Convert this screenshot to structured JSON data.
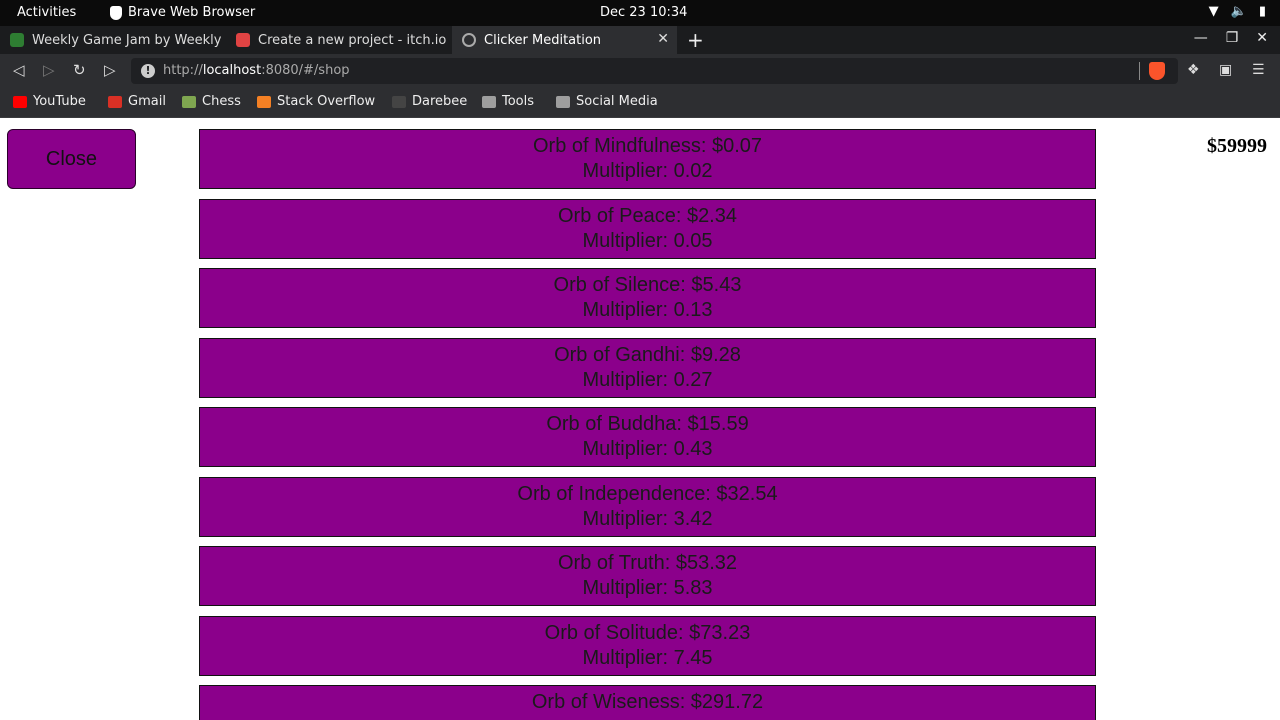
{
  "system": {
    "activities": "Activities",
    "app_name": "Brave Web Browser",
    "clock": "Dec 23  10:34"
  },
  "tabs": [
    {
      "title": "Weekly Game Jam by Weekly",
      "fav_color": "#2e7d32"
    },
    {
      "title": "Create a new project - itch.io",
      "fav_color": "#e04343"
    },
    {
      "title": "Clicker Meditation",
      "fav_color": "#666666"
    }
  ],
  "url": {
    "scheme": "http://",
    "host": "localhost",
    "rest": ":8080/#/shop"
  },
  "bookmarks": [
    {
      "label": "YouTube",
      "color": "#ff0000"
    },
    {
      "label": "Gmail",
      "color": "#d93025"
    },
    {
      "label": "Chess",
      "color": "#7fa650"
    },
    {
      "label": "Stack Overflow",
      "color": "#f48024"
    },
    {
      "label": "Darebee",
      "color": "#444444"
    },
    {
      "label": "Tools",
      "color": "#9e9e9e"
    },
    {
      "label": "Social Media",
      "color": "#9e9e9e"
    }
  ],
  "page": {
    "close_label": "Close",
    "balance": "$59999",
    "items": [
      {
        "name": "Orb of Mindfulness: $0.07",
        "multiplier": "Multiplier: 0.02"
      },
      {
        "name": "Orb of Peace: $2.34",
        "multiplier": "Multiplier: 0.05"
      },
      {
        "name": "Orb of Silence: $5.43",
        "multiplier": "Multiplier: 0.13"
      },
      {
        "name": "Orb of Gandhi: $9.28",
        "multiplier": "Multiplier: 0.27"
      },
      {
        "name": "Orb of Buddha: $15.59",
        "multiplier": "Multiplier: 0.43"
      },
      {
        "name": "Orb of Independence: $32.54",
        "multiplier": "Multiplier: 3.42"
      },
      {
        "name": "Orb of Truth: $53.32",
        "multiplier": "Multiplier: 5.83"
      },
      {
        "name": "Orb of Solitude: $73.23",
        "multiplier": "Multiplier: 7.45"
      },
      {
        "name": "Orb of Wiseness: $291.72",
        "multiplier": ""
      }
    ]
  }
}
